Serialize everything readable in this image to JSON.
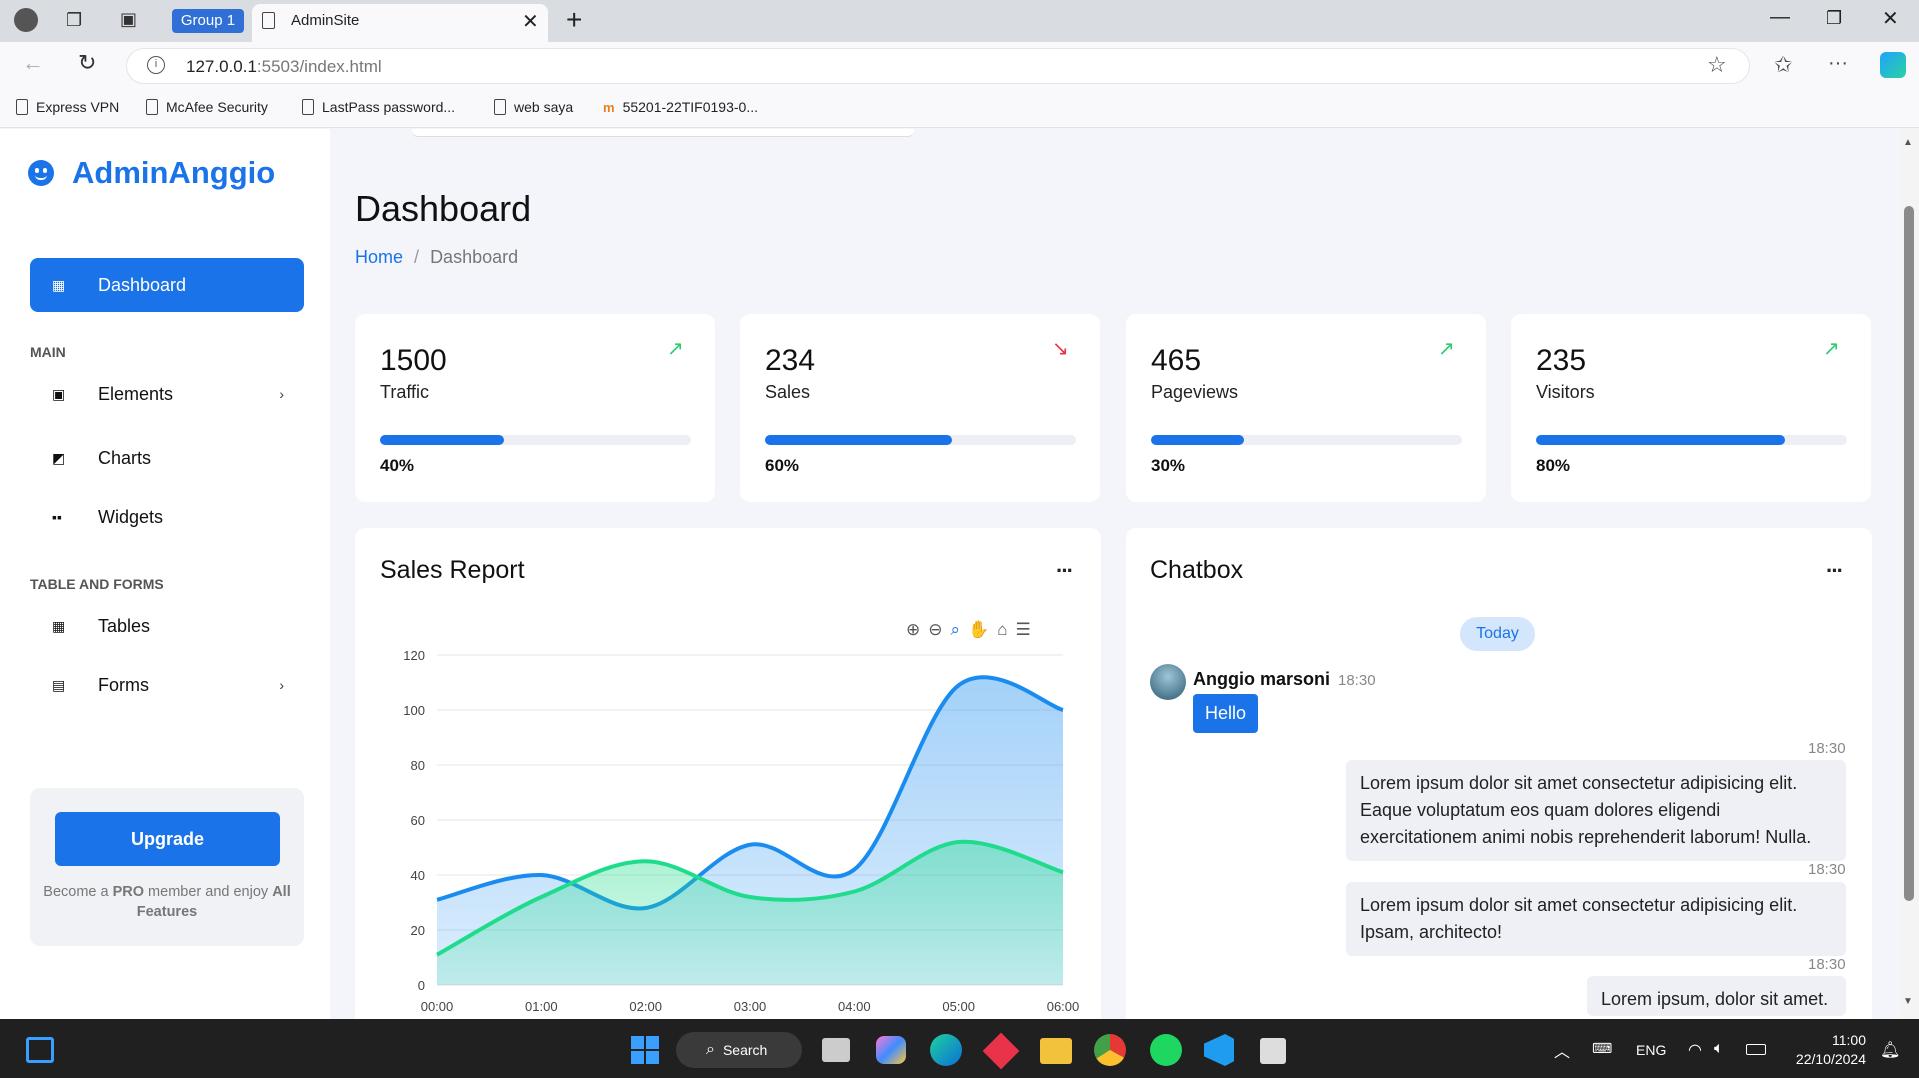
{
  "browser": {
    "group_label": "Group 1",
    "tab_title": "AdminSite",
    "url_host": "127.0.0.1",
    "url_rest": ":5503/index.html",
    "bookmarks": [
      "Express VPN",
      "McAfee Security",
      "LastPass password...",
      "web saya",
      "55201-22TIF0193-0..."
    ]
  },
  "sidebar": {
    "brand": "AdminAnggio",
    "active_item": "Dashboard",
    "section_main": "MAIN",
    "items_main": [
      "Elements",
      "Charts",
      "Widgets"
    ],
    "section_forms": "TABLE AND FORMS",
    "items_forms": [
      "Tables",
      "Forms"
    ],
    "upgrade_button": "Upgrade",
    "upgrade_text_1": "Become a ",
    "upgrade_pro": "PRO",
    "upgrade_text_2": " member and enjoy ",
    "upgrade_all": "All Features"
  },
  "header": {
    "title": "Dashboard",
    "breadcrumb_home": "Home",
    "breadcrumb_sep": "/",
    "breadcrumb_current": "Dashboard"
  },
  "stats": [
    {
      "value": "1500",
      "label": "Traffic",
      "percent": "40%",
      "fill": 0.4,
      "trend": "up"
    },
    {
      "value": "234",
      "label": "Sales",
      "percent": "60%",
      "fill": 0.6,
      "trend": "down"
    },
    {
      "value": "465",
      "label": "Pageviews",
      "percent": "30%",
      "fill": 0.3,
      "trend": "up"
    },
    {
      "value": "235",
      "label": "Visitors",
      "percent": "80%",
      "fill": 0.8,
      "trend": "up"
    }
  ],
  "colors": {
    "accent": "#1a73e8",
    "up": "#2ecc71",
    "down": "#e8334a",
    "series1": "#1a8cf0",
    "series2": "#1fdc8c"
  },
  "sales_report": {
    "title": "Sales Report",
    "menu": "···"
  },
  "chart_data": {
    "type": "area",
    "x": [
      "00:00",
      "01:00",
      "02:00",
      "03:00",
      "04:00",
      "05:00",
      "06:00"
    ],
    "ylim": [
      0,
      120
    ],
    "yticks": [
      0,
      20,
      40,
      60,
      80,
      100,
      120
    ],
    "series": [
      {
        "values": [
          31,
          40,
          28,
          51,
          42,
          109,
          100
        ]
      },
      {
        "values": [
          11,
          32,
          45,
          32,
          34,
          52,
          41
        ]
      }
    ],
    "grid": true
  },
  "chatbox": {
    "title": "Chatbox",
    "menu": "···",
    "day_label": "Today",
    "user_name": "Anggio marsoni",
    "user_time": "18:30",
    "user_msg": "Hello",
    "replies": [
      {
        "time": "18:30",
        "text": "Lorem ipsum dolor sit amet consectetur adipisicing elit. Eaque voluptatum eos quam dolores eligendi exercitationem animi nobis reprehenderit laborum! Nulla."
      },
      {
        "time": "18:30",
        "text": "Lorem ipsum dolor sit amet consectetur adipisicing elit. Ipsam, architecto!"
      },
      {
        "time": "18:30",
        "text": "Lorem ipsum, dolor sit amet."
      }
    ]
  },
  "taskbar": {
    "search": "Search",
    "lang": "ENG",
    "time": "11:00",
    "date": "22/10/2024"
  }
}
